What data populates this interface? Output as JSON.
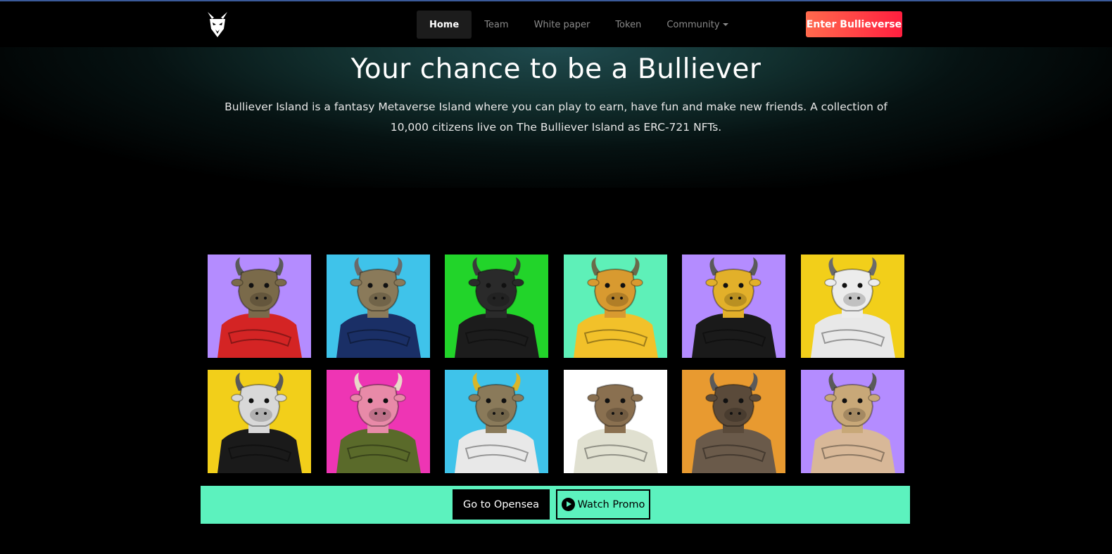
{
  "nav": {
    "links": [
      "Home",
      "Team",
      "White paper",
      "Token",
      "Community"
    ],
    "active": "Home",
    "cta_label": "Enter Bullieverse"
  },
  "hero": {
    "title": "Your chance to be a Bulliever",
    "description": "Bulliever Island is a fantasy Metaverse Island where you can play to earn, have fun and make new friends. A collection of 10,000 citizens live on The Bulliever Island as ERC-721 NFTs."
  },
  "gallery": {
    "tiles": [
      {
        "bg": "#b48cff",
        "outfit": "#d42424",
        "horns": "#5a5a5a",
        "head": "#7a6a4a"
      },
      {
        "bg": "#3fc3ea",
        "outfit": "#1a2f66",
        "horns": "#6a6a6a",
        "head": "#8a7a5a"
      },
      {
        "bg": "#22d42a",
        "outfit": "#1c1c1c",
        "horns": "#3a3a3a",
        "head": "#2a2a2a"
      },
      {
        "bg": "#5ef0b8",
        "outfit": "#f2c12a",
        "horns": "#6a6a4a",
        "head": "#d89a30"
      },
      {
        "bg": "#b48cff",
        "outfit": "#1a1a1a",
        "horns": "#5a5a5a",
        "head": "#e2b02a"
      },
      {
        "bg": "#f2cf1a",
        "outfit": "#e8e8e8",
        "horns": "#6a6a6a",
        "head": "#ececec"
      },
      {
        "bg": "#f2cf1a",
        "outfit": "#1a1a1a",
        "horns": "#5a5a5a",
        "head": "#d8d8d8"
      },
      {
        "bg": "#ee35b4",
        "outfit": "#5a6a2a",
        "horns": "#e8d8c8",
        "head": "#e88aa8"
      },
      {
        "bg": "#3fc3ea",
        "outfit": "#e8e8e8",
        "horns": "#d8b62a",
        "head": "#8a7a5a"
      },
      {
        "bg": "#ffffff",
        "outfit": "#e0e0d0",
        "horns": "#ffffff",
        "head": "#8a7050"
      },
      {
        "bg": "#e89a30",
        "outfit": "#6a5a4a",
        "horns": "#5a5a5a",
        "head": "#5a4a3a"
      },
      {
        "bg": "#b48cff",
        "outfit": "#d8b898",
        "horns": "#5a5a5a",
        "head": "#c8a878"
      }
    ]
  },
  "actions": {
    "opensea_label": "Go to Opensea",
    "promo_label": "Watch Promo"
  }
}
